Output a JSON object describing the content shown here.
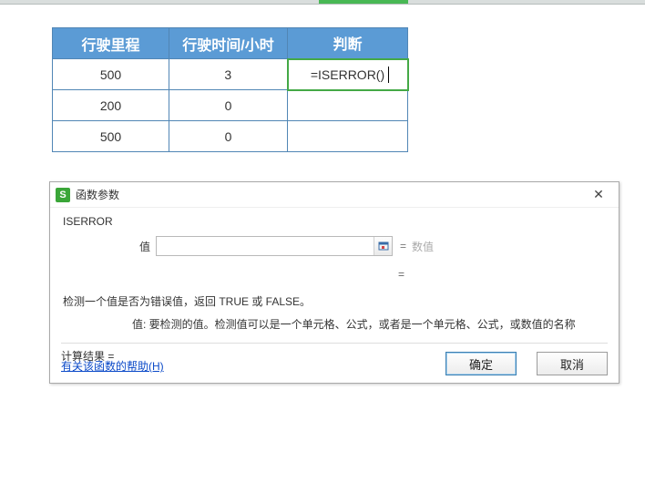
{
  "table": {
    "headers": [
      "行驶里程",
      "行驶时间/小时",
      "判断"
    ],
    "rows": [
      {
        "mileage": "500",
        "hours": "3",
        "judgment": "=ISERROR()"
      },
      {
        "mileage": "200",
        "hours": "0",
        "judgment": ""
      },
      {
        "mileage": "500",
        "hours": "0",
        "judgment": ""
      }
    ],
    "editing_cell": {
      "row": 0,
      "col": 2
    }
  },
  "dialog": {
    "title": "函数参数",
    "function_name": "ISERROR",
    "argument": {
      "label": "值",
      "value": "",
      "eq_symbol": "=",
      "hint": "数值"
    },
    "formula_eq": "=",
    "description": "检测一个值是否为错误值，返回 TRUE 或 FALSE。",
    "arg_description": "值: 要检测的值。检测值可以是一个单元格、公式，或者是一个单元格、公式，或数值的名称",
    "result_label": "计算结果 =",
    "result_value": "",
    "help_link": "有关该函数的帮助(H)",
    "buttons": {
      "ok": "确定",
      "cancel": "取消"
    },
    "icon_letter": "S"
  }
}
